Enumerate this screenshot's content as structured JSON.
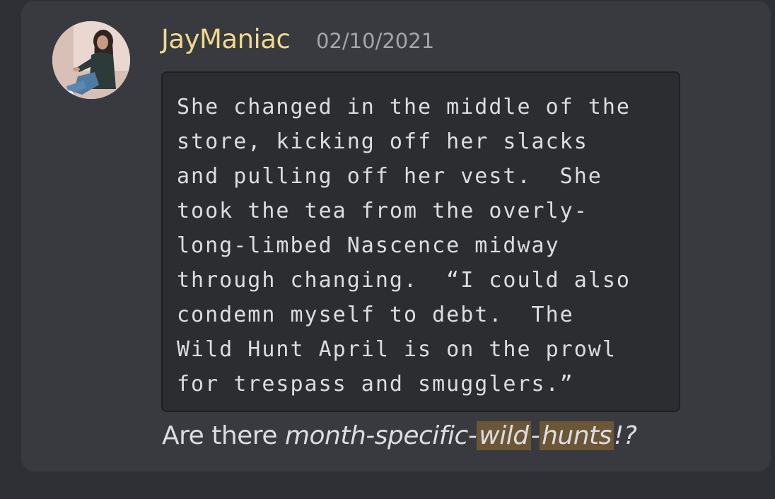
{
  "message": {
    "author": "JayManiac",
    "timestamp": "02/10/2021",
    "avatar_icon": "user-avatar-photo",
    "code_lines": [
      "She changed in the middle of the",
      "store, kicking off her slacks",
      "and pulling off her vest.  She",
      "took the tea from the overly-",
      "long-limbed Nascence midway",
      "through changing.  “I could also",
      "condemn myself to debt.  The",
      "Wild Hunt April is on the prowl",
      "for trespass and smugglers.”"
    ]
  },
  "reply": {
    "prefix": "Are there ",
    "italic_start": "month-specific-",
    "highlight_1": "wild",
    "italic_sep": "-",
    "highlight_2": "hunts",
    "italic_end": "!?",
    "highlight_color": "#6b5637"
  },
  "colors": {
    "background": "#2e3035",
    "card": "#383a40",
    "username": "#f0d98c",
    "timestamp": "#a3a6ab",
    "code_bg": "#2b2d31"
  }
}
